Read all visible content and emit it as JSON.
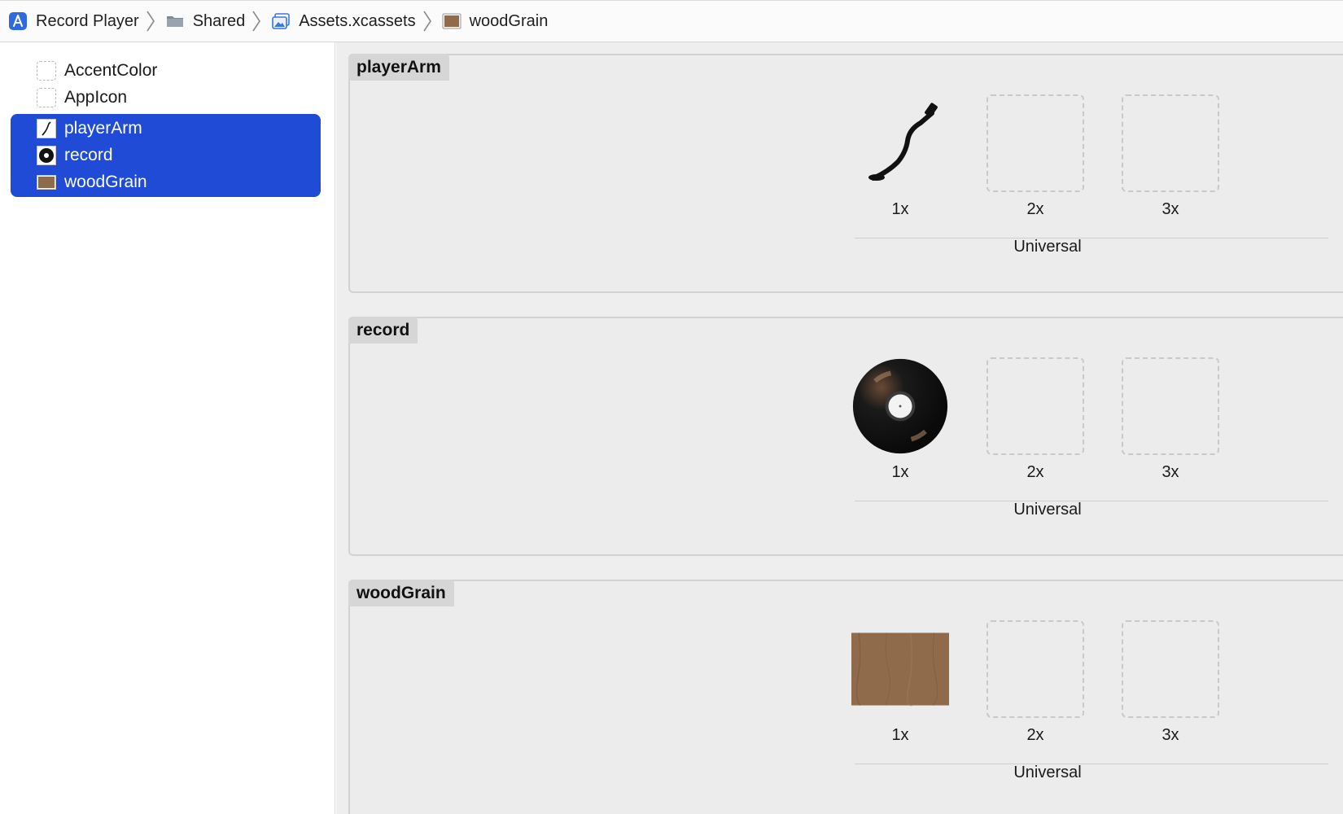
{
  "breadcrumb": {
    "items": [
      {
        "label": "Record Player",
        "icon": "app-project-icon"
      },
      {
        "label": "Shared",
        "icon": "folder-icon"
      },
      {
        "label": "Assets.xcassets",
        "icon": "asset-catalog-icon"
      },
      {
        "label": "woodGrain",
        "icon": "image-set-icon"
      }
    ]
  },
  "sidebar": {
    "items": [
      {
        "label": "AccentColor",
        "selected": false
      },
      {
        "label": "AppIcon",
        "selected": false
      },
      {
        "label": "playerArm",
        "selected": true
      },
      {
        "label": "record",
        "selected": true
      },
      {
        "label": "woodGrain",
        "selected": true
      }
    ],
    "selection_color": "#1f4bd6"
  },
  "editor": {
    "sets": [
      {
        "name": "playerArm",
        "slots": [
          "1x",
          "2x",
          "3x"
        ],
        "group_label": "Universal"
      },
      {
        "name": "record",
        "slots": [
          "1x",
          "2x",
          "3x"
        ],
        "group_label": "Universal"
      },
      {
        "name": "woodGrain",
        "slots": [
          "1x",
          "2x",
          "3x"
        ],
        "group_label": "Universal"
      }
    ]
  },
  "colors": {
    "wood": "#8f6b4c",
    "vinyl": "#111111"
  }
}
